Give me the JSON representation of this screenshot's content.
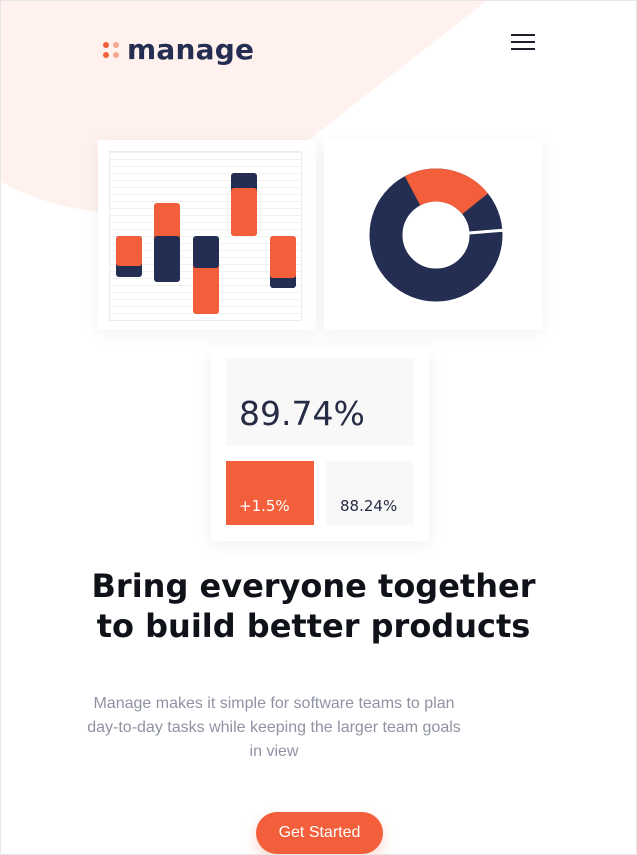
{
  "brand": {
    "name": "manage",
    "accent": "#f25f3a",
    "navy": "#242d52"
  },
  "header": {
    "menu_icon": "hamburger-menu-icon"
  },
  "charts": {
    "bar_colors": [
      "#242d52",
      "#f25f3a"
    ],
    "donut_colors": [
      "#f25f3a",
      "#242d52"
    ],
    "donut_orange_fraction": 0.22
  },
  "stats": {
    "main_value": "89.74%",
    "change_value": "+1.5%",
    "secondary_value": "88.24%"
  },
  "hero": {
    "headline_line1": "Bring everyone together",
    "headline_line2": "to build better products",
    "lead_line1": "Manage makes it simple for software teams to plan",
    "lead_line2": "day-to-day tasks while keeping the larger team goals",
    "lead_line3": "in view",
    "cta_label": "Get Started"
  }
}
